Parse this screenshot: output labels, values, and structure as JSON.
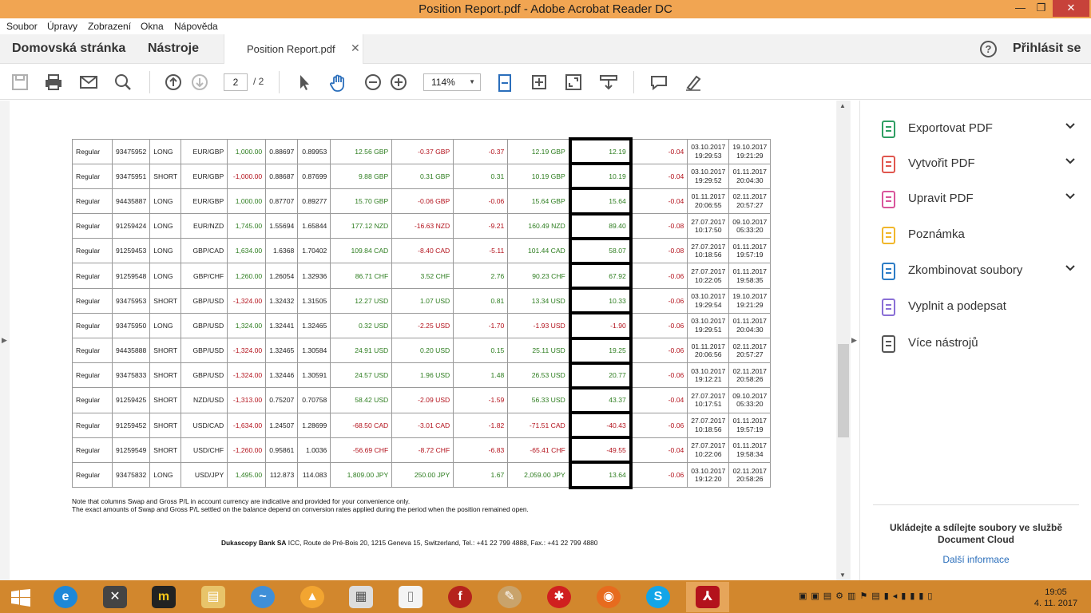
{
  "window": {
    "title": "Position Report.pdf - Adobe Acrobat Reader DC"
  },
  "menu": [
    "Soubor",
    "Úpravy",
    "Zobrazení",
    "Okna",
    "Nápověda"
  ],
  "tabs": {
    "home": "Domovská stránka",
    "tools": "Nástroje",
    "document": "Position Report.pdf",
    "signin": "Přihlásit se"
  },
  "toolbar": {
    "page_current": "2",
    "page_total": "/ 2",
    "zoom": "114%"
  },
  "table": {
    "rows": [
      {
        "type": "Regular",
        "id": "93475952",
        "side": "LONG",
        "pair": "EUR/GBP",
        "amount": "1,000.00",
        "open": "0.88697",
        "close": "0.89953",
        "gross": "12.56 GBP",
        "swap": "-0.37 GBP",
        "swap_acc": "-0.37",
        "net": "12.19 GBP",
        "net_acc": "12.19",
        "comm": "-0.04",
        "open_date": "03.10.2017",
        "open_time": "19:29:53",
        "close_date": "19.10.2017",
        "close_time": "19:21:29",
        "c_amount": "g",
        "c_gross": "g",
        "c_swap": "r",
        "c_swap_acc": "r",
        "c_net": "g",
        "c_net_acc": "g"
      },
      {
        "type": "Regular",
        "id": "93475951",
        "side": "SHORT",
        "pair": "EUR/GBP",
        "amount": "-1,000.00",
        "open": "0.88687",
        "close": "0.87699",
        "gross": "9.88 GBP",
        "swap": "0.31 GBP",
        "swap_acc": "0.31",
        "net": "10.19 GBP",
        "net_acc": "10.19",
        "comm": "-0.04",
        "open_date": "03.10.2017",
        "open_time": "19:29:52",
        "close_date": "01.11.2017",
        "close_time": "20:04:30",
        "c_amount": "r",
        "c_gross": "g",
        "c_swap": "g",
        "c_swap_acc": "g",
        "c_net": "g",
        "c_net_acc": "g"
      },
      {
        "type": "Regular",
        "id": "94435887",
        "side": "LONG",
        "pair": "EUR/GBP",
        "amount": "1,000.00",
        "open": "0.87707",
        "close": "0.89277",
        "gross": "15.70 GBP",
        "swap": "-0.06 GBP",
        "swap_acc": "-0.06",
        "net": "15.64 GBP",
        "net_acc": "15.64",
        "comm": "-0.04",
        "open_date": "01.11.2017",
        "open_time": "20:06:55",
        "close_date": "02.11.2017",
        "close_time": "20:57:27",
        "c_amount": "g",
        "c_gross": "g",
        "c_swap": "r",
        "c_swap_acc": "r",
        "c_net": "g",
        "c_net_acc": "g"
      },
      {
        "type": "Regular",
        "id": "91259424",
        "side": "LONG",
        "pair": "EUR/NZD",
        "amount": "1,745.00",
        "open": "1.55694",
        "close": "1.65844",
        "gross": "177.12 NZD",
        "swap": "-16.63 NZD",
        "swap_acc": "-9.21",
        "net": "160.49 NZD",
        "net_acc": "89.40",
        "comm": "-0.08",
        "open_date": "27.07.2017",
        "open_time": "10:17:50",
        "close_date": "09.10.2017",
        "close_time": "05:33:20",
        "c_amount": "g",
        "c_gross": "g",
        "c_swap": "r",
        "c_swap_acc": "r",
        "c_net": "g",
        "c_net_acc": "g"
      },
      {
        "type": "Regular",
        "id": "91259453",
        "side": "LONG",
        "pair": "GBP/CAD",
        "amount": "1,634.00",
        "open": "1.6368",
        "close": "1.70402",
        "gross": "109.84 CAD",
        "swap": "-8.40 CAD",
        "swap_acc": "-5.11",
        "net": "101.44 CAD",
        "net_acc": "58.07",
        "comm": "-0.08",
        "open_date": "27.07.2017",
        "open_time": "10:18:56",
        "close_date": "01.11.2017",
        "close_time": "19:57:19",
        "c_amount": "g",
        "c_gross": "g",
        "c_swap": "r",
        "c_swap_acc": "r",
        "c_net": "g",
        "c_net_acc": "g"
      },
      {
        "type": "Regular",
        "id": "91259548",
        "side": "LONG",
        "pair": "GBP/CHF",
        "amount": "1,260.00",
        "open": "1.26054",
        "close": "1.32936",
        "gross": "86.71 CHF",
        "swap": "3.52 CHF",
        "swap_acc": "2.76",
        "net": "90.23 CHF",
        "net_acc": "67.92",
        "comm": "-0.06",
        "open_date": "27.07.2017",
        "open_time": "10:22:05",
        "close_date": "01.11.2017",
        "close_time": "19:58:35",
        "c_amount": "g",
        "c_gross": "g",
        "c_swap": "g",
        "c_swap_acc": "g",
        "c_net": "g",
        "c_net_acc": "g"
      },
      {
        "type": "Regular",
        "id": "93475953",
        "side": "SHORT",
        "pair": "GBP/USD",
        "amount": "-1,324.00",
        "open": "1.32432",
        "close": "1.31505",
        "gross": "12.27 USD",
        "swap": "1.07 USD",
        "swap_acc": "0.81",
        "net": "13.34 USD",
        "net_acc": "10.33",
        "comm": "-0.06",
        "open_date": "03.10.2017",
        "open_time": "19:29:54",
        "close_date": "19.10.2017",
        "close_time": "19:21:29",
        "c_amount": "r",
        "c_gross": "g",
        "c_swap": "g",
        "c_swap_acc": "g",
        "c_net": "g",
        "c_net_acc": "g"
      },
      {
        "type": "Regular",
        "id": "93475950",
        "side": "LONG",
        "pair": "GBP/USD",
        "amount": "1,324.00",
        "open": "1.32441",
        "close": "1.32465",
        "gross": "0.32 USD",
        "swap": "-2.25 USD",
        "swap_acc": "-1.70",
        "net": "-1.93 USD",
        "net_acc": "-1.90",
        "comm": "-0.06",
        "open_date": "03.10.2017",
        "open_time": "19:29:51",
        "close_date": "01.11.2017",
        "close_time": "20:04:30",
        "c_amount": "g",
        "c_gross": "g",
        "c_swap": "r",
        "c_swap_acc": "r",
        "c_net": "r",
        "c_net_acc": "r"
      },
      {
        "type": "Regular",
        "id": "94435888",
        "side": "SHORT",
        "pair": "GBP/USD",
        "amount": "-1,324.00",
        "open": "1.32465",
        "close": "1.30584",
        "gross": "24.91 USD",
        "swap": "0.20 USD",
        "swap_acc": "0.15",
        "net": "25.11 USD",
        "net_acc": "19.25",
        "comm": "-0.06",
        "open_date": "01.11.2017",
        "open_time": "20:06:56",
        "close_date": "02.11.2017",
        "close_time": "20:57:27",
        "c_amount": "r",
        "c_gross": "g",
        "c_swap": "g",
        "c_swap_acc": "g",
        "c_net": "g",
        "c_net_acc": "g"
      },
      {
        "type": "Regular",
        "id": "93475833",
        "side": "SHORT",
        "pair": "GBP/USD",
        "amount": "-1,324.00",
        "open": "1.32446",
        "close": "1.30591",
        "gross": "24.57 USD",
        "swap": "1.96 USD",
        "swap_acc": "1.48",
        "net": "26.53 USD",
        "net_acc": "20.77",
        "comm": "-0.06",
        "open_date": "03.10.2017",
        "open_time": "19:12:21",
        "close_date": "02.11.2017",
        "close_time": "20:58:26",
        "c_amount": "r",
        "c_gross": "g",
        "c_swap": "g",
        "c_swap_acc": "g",
        "c_net": "g",
        "c_net_acc": "g"
      },
      {
        "type": "Regular",
        "id": "91259425",
        "side": "SHORT",
        "pair": "NZD/USD",
        "amount": "-1,313.00",
        "open": "0.75207",
        "close": "0.70758",
        "gross": "58.42 USD",
        "swap": "-2.09 USD",
        "swap_acc": "-1.59",
        "net": "56.33 USD",
        "net_acc": "43.37",
        "comm": "-0.04",
        "open_date": "27.07.2017",
        "open_time": "10:17:51",
        "close_date": "09.10.2017",
        "close_time": "05:33:20",
        "c_amount": "r",
        "c_gross": "g",
        "c_swap": "r",
        "c_swap_acc": "r",
        "c_net": "g",
        "c_net_acc": "g"
      },
      {
        "type": "Regular",
        "id": "91259452",
        "side": "SHORT",
        "pair": "USD/CAD",
        "amount": "-1,634.00",
        "open": "1.24507",
        "close": "1.28699",
        "gross": "-68.50 CAD",
        "swap": "-3.01 CAD",
        "swap_acc": "-1.82",
        "net": "-71.51 CAD",
        "net_acc": "-40.43",
        "comm": "-0.06",
        "open_date": "27.07.2017",
        "open_time": "10:18:56",
        "close_date": "01.11.2017",
        "close_time": "19:57:19",
        "c_amount": "r",
        "c_gross": "r",
        "c_swap": "r",
        "c_swap_acc": "r",
        "c_net": "r",
        "c_net_acc": "r"
      },
      {
        "type": "Regular",
        "id": "91259549",
        "side": "SHORT",
        "pair": "USD/CHF",
        "amount": "-1,260.00",
        "open": "0.95861",
        "close": "1.0036",
        "gross": "-56.69 CHF",
        "swap": "-8.72 CHF",
        "swap_acc": "-6.83",
        "net": "-65.41 CHF",
        "net_acc": "-49.55",
        "comm": "-0.04",
        "open_date": "27.07.2017",
        "open_time": "10:22:06",
        "close_date": "01.11.2017",
        "close_time": "19:58:34",
        "c_amount": "r",
        "c_gross": "r",
        "c_swap": "r",
        "c_swap_acc": "r",
        "c_net": "r",
        "c_net_acc": "r"
      },
      {
        "type": "Regular",
        "id": "93475832",
        "side": "LONG",
        "pair": "USD/JPY",
        "amount": "1,495.00",
        "open": "112.873",
        "close": "114.083",
        "gross": "1,809.00 JPY",
        "swap": "250.00 JPY",
        "swap_acc": "1.67",
        "net": "2,059.00 JPY",
        "net_acc": "13.64",
        "comm": "-0.06",
        "open_date": "03.10.2017",
        "open_time": "19:12:20",
        "close_date": "02.11.2017",
        "close_time": "20:58:26",
        "c_amount": "g",
        "c_gross": "g",
        "c_swap": "g",
        "c_swap_acc": "g",
        "c_net": "g",
        "c_net_acc": "g"
      }
    ]
  },
  "note": {
    "line1": "Note that columns Swap and Gross P/L in account currency are indicative and provided for your convenience only.",
    "line2": "The exact amounts of Swap and Gross P/L settled on the balance depend on conversion rates applied during the period when the position remained open."
  },
  "footer": {
    "bank": "Dukascopy Bank SA",
    "address": " ICC, Route de Pré-Bois 20, 1215 Geneva 15, Switzerland, Tel.: +41 22 799 4888, Fax.: +41 22 799 4880"
  },
  "right_panel": {
    "tools": [
      {
        "label": "Exportovat PDF",
        "icon": "export-pdf-icon",
        "color": "#2f9e63",
        "chevron": true
      },
      {
        "label": "Vytvořit PDF",
        "icon": "create-pdf-icon",
        "color": "#e0574f",
        "chevron": true
      },
      {
        "label": "Upravit PDF",
        "icon": "edit-pdf-icon",
        "color": "#d9559b",
        "chevron": true
      },
      {
        "label": "Poznámka",
        "icon": "comment-icon",
        "color": "#f1b72b",
        "chevron": false
      },
      {
        "label": "Zkombinovat soubory",
        "icon": "combine-files-icon",
        "color": "#2c7cc6",
        "chevron": true
      },
      {
        "label": "Vyplnit a podepsat",
        "icon": "fill-sign-icon",
        "color": "#8a6fd6",
        "chevron": false
      },
      {
        "label": "Více nástrojů",
        "icon": "more-tools-icon",
        "color": "#555555",
        "chevron": false
      }
    ],
    "cloud_text": "Ukládejte a sdílejte soubory ve službě Document Cloud",
    "cloud_link": "Další informace"
  },
  "taskbar": {
    "time": "19:05",
    "date": "4. 11. 2017"
  }
}
